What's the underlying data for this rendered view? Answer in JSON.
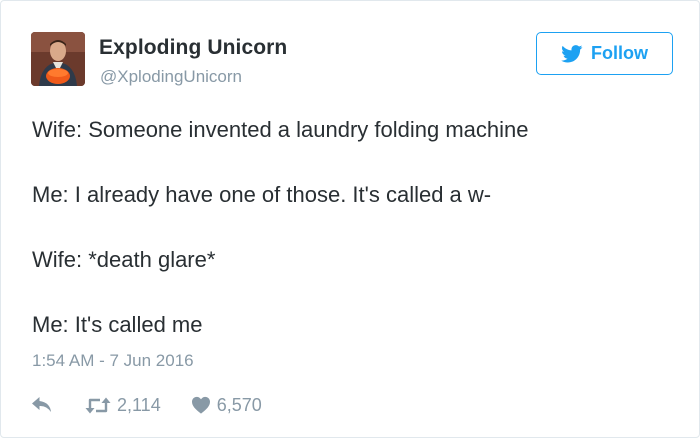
{
  "user": {
    "display_name": "Exploding Unicorn",
    "handle": "@XplodingUnicorn"
  },
  "follow_button": {
    "label": "Follow",
    "icon": "twitter-bird-icon"
  },
  "tweet": {
    "lines": [
      "Wife: Someone invented a laundry folding machine",
      "Me: I already have one of those. It's called a w-",
      "Wife: *death glare*",
      "Me: It's called me"
    ],
    "timestamp": "1:54 AM - 7 Jun 2016"
  },
  "actions": {
    "reply_icon": "reply-icon",
    "retweet_icon": "retweet-icon",
    "retweet_count": "2,114",
    "like_icon": "heart-icon",
    "like_count": "6,570"
  },
  "colors": {
    "accent": "#1da1f2",
    "text": "#292f33",
    "muted": "#8899a6",
    "border": "#e1e8ed"
  }
}
